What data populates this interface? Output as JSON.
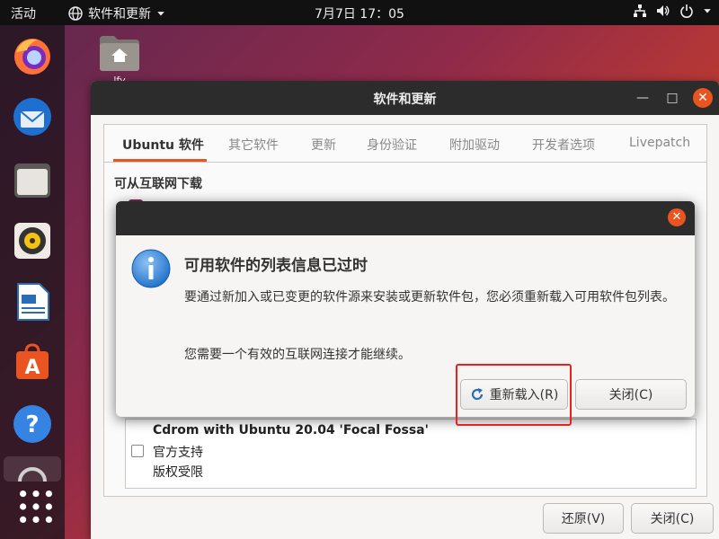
{
  "topbar": {
    "activities": "活动",
    "app_menu": "软件和更新",
    "clock": "7月7日  17：05",
    "icons": [
      "network-icon",
      "volume-icon",
      "power-icon",
      "chevron-down-icon"
    ]
  },
  "dock": {
    "items": [
      "firefox-icon",
      "thunderbird-icon",
      "files-icon",
      "rhythmbox-icon",
      "libreoffice-writer-icon",
      "software-icon",
      "help-icon"
    ]
  },
  "desktop": {
    "home_label": "lfy"
  },
  "window": {
    "title": "软件和更新",
    "tabs": [
      "Ubuntu 软件",
      "其它软件",
      "更新",
      "身份验证",
      "附加驱动",
      "开发者选项",
      "Livepatch"
    ],
    "active_tab": 0,
    "section_title": "可从互联网下载",
    "cdrom": {
      "title": "Cdrom with Ubuntu 20.04 'Focal Fossa'",
      "options": [
        "官方支持",
        "版权受限"
      ]
    },
    "buttons": {
      "revert": "还原(V)",
      "close": "关闭(C)"
    }
  },
  "dialog": {
    "title": "可用软件的列表信息已过时",
    "message": "要通过新加入或已变更的软件源来安装或更新软件包，您必须重新载入可用软件包列表。",
    "note": "您需要一个有效的互联网连接才能继续。",
    "reload_button": "重新载入(R)",
    "close_button": "关闭(C)"
  },
  "colors": {
    "accent": "#e95420",
    "highlight_box": "#e8231d",
    "titlebar": "#2c2c2c"
  }
}
